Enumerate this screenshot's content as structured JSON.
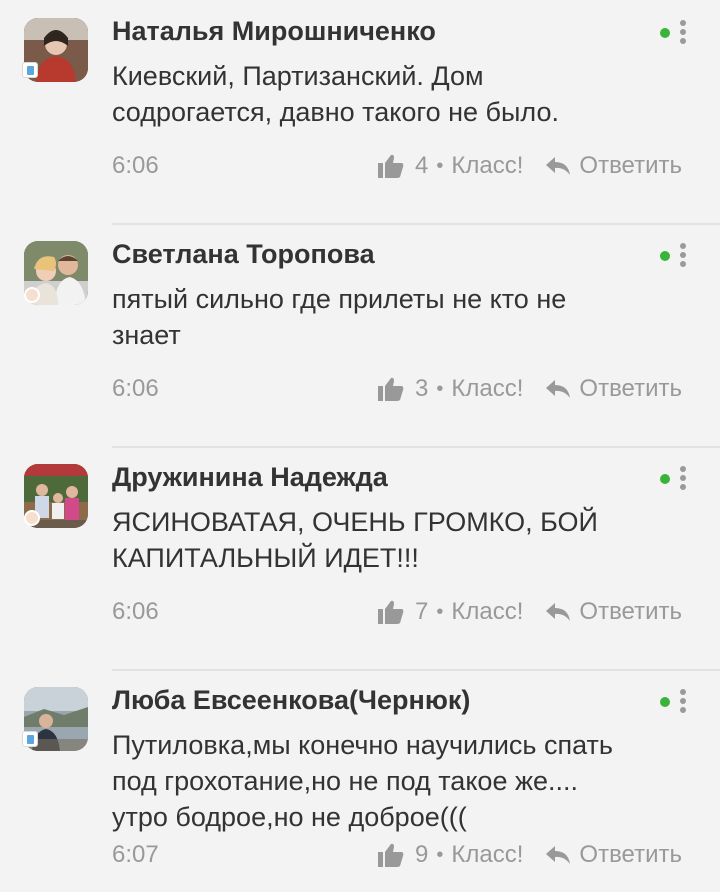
{
  "comments": [
    {
      "author": "Наталья Мирошниченко",
      "text_lines": [
        "Киевский, Партизанский. Дом",
        "содрогается, давно такого не было."
      ],
      "time": "6:06",
      "likes": "4",
      "like_label": "Класс!",
      "reply_label": "Ответить",
      "badge": "device"
    },
    {
      "author": "Светлана Торопова",
      "text_lines": [
        "пятый сильно где прилеты не кто не",
        "знает"
      ],
      "time": "6:06",
      "likes": "3",
      "like_label": "Класс!",
      "reply_label": "Ответить",
      "badge": "dot"
    },
    {
      "author": "Дружинина Надежда",
      "text_lines": [
        "ЯСИНОВАТАЯ, ОЧЕНЬ ГРОМКО, БОЙ",
        "КАПИТАЛЬНЫЙ ИДЕТ!!!"
      ],
      "time": "6:06",
      "likes": "7",
      "like_label": "Класс!",
      "reply_label": "Ответить",
      "badge": "dot"
    },
    {
      "author": "Люба Евсеенкова(Чернюк)",
      "text_lines": [
        "Путиловка,мы конечно научились спать",
        "под грохотание,но не под такое же....",
        "утро бодрое,но не доброе((("
      ],
      "time": "6:07",
      "likes": "9",
      "like_label": "Класс!",
      "reply_label": "Ответить",
      "badge": "device"
    }
  ],
  "colors": {
    "background": "#f3f3f3",
    "online": "#3bb33b",
    "muted_text": "#999999",
    "primary_text": "#333333"
  },
  "icons": {
    "like": "thumb-up-icon",
    "reply": "reply-arrow-icon",
    "menu": "vertical-dots-icon",
    "online": "online-dot-icon"
  }
}
